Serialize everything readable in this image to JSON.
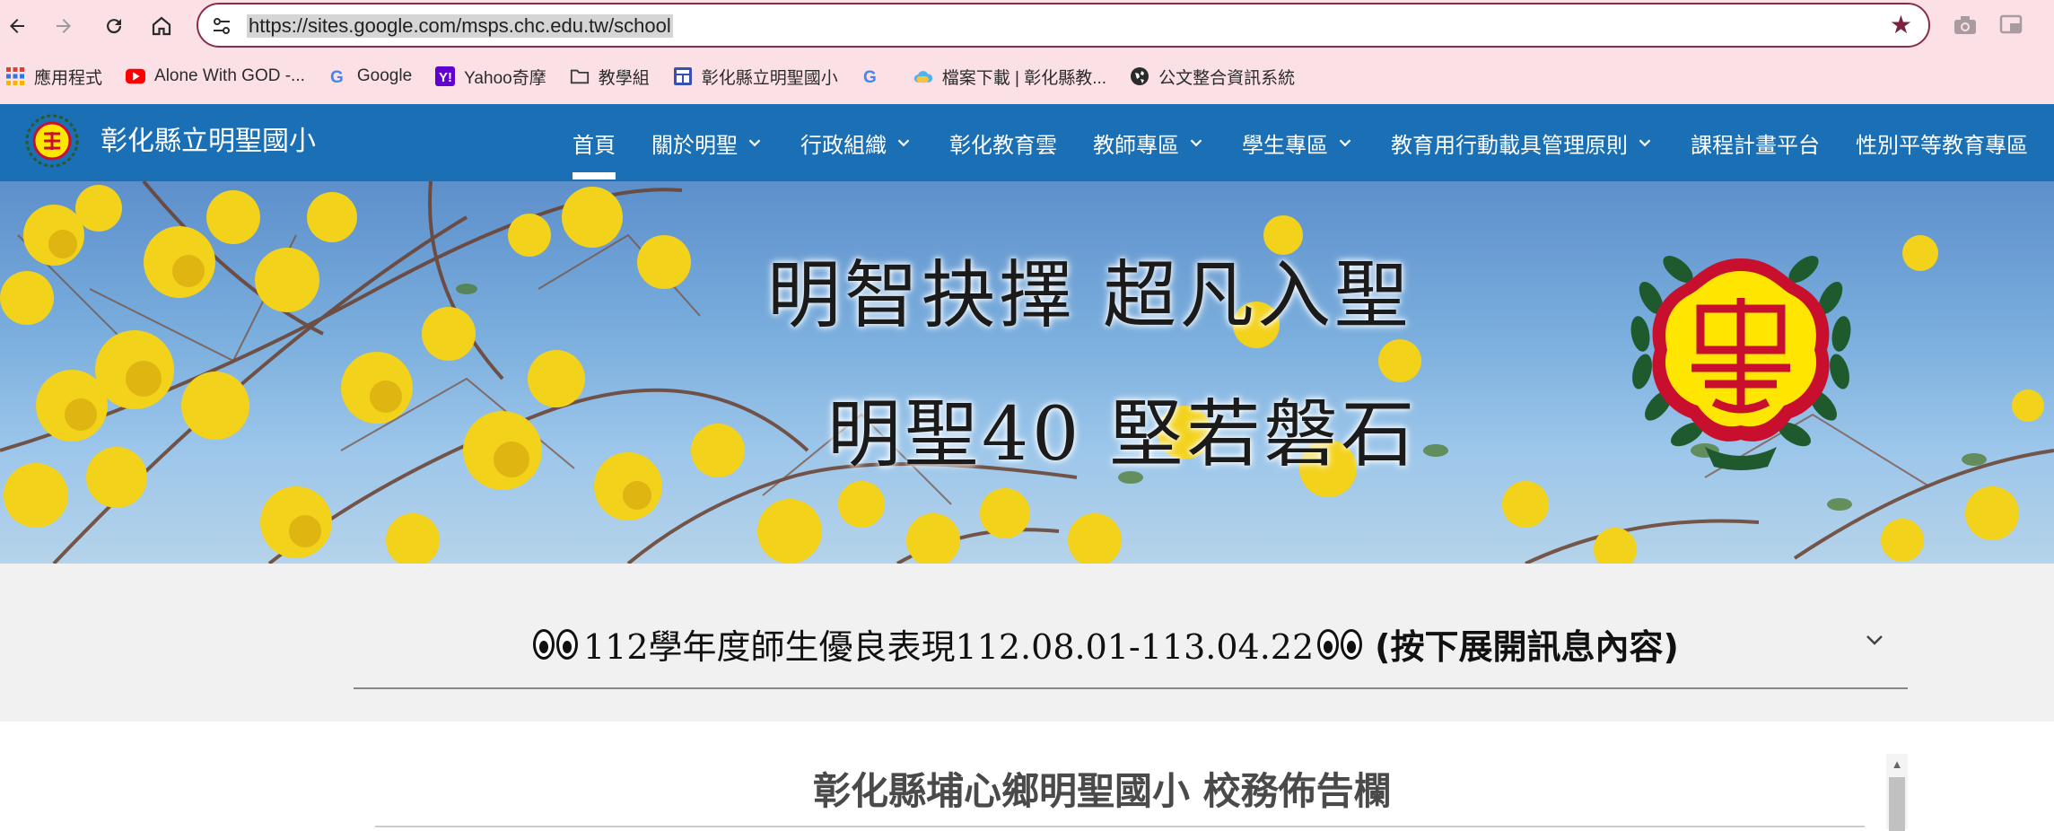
{
  "browser": {
    "url": "https://sites.google.com/msps.chc.edu.tw/school",
    "bookmarks": [
      {
        "label": "應用程式",
        "icon": "apps-grid-icon"
      },
      {
        "label": "Alone With GOD -...",
        "icon": "youtube-icon"
      },
      {
        "label": "Google",
        "icon": "google-icon"
      },
      {
        "label": "Yahoo奇摩",
        "icon": "yahoo-icon"
      },
      {
        "label": "教學組",
        "icon": "folder-icon"
      },
      {
        "label": "彰化縣立明聖國小",
        "icon": "sites-icon"
      },
      {
        "label": "",
        "icon": "google-icon"
      },
      {
        "label": "檔案下載 | 彰化縣教...",
        "icon": "cloud-icon"
      },
      {
        "label": "公文整合資訊系統",
        "icon": "globe-icon"
      }
    ]
  },
  "site": {
    "title": "彰化縣立明聖國小",
    "nav": [
      {
        "label": "首頁",
        "dropdown": false,
        "active": true
      },
      {
        "label": "關於明聖",
        "dropdown": true,
        "active": false
      },
      {
        "label": "行政組織",
        "dropdown": true,
        "active": false
      },
      {
        "label": "彰化教育雲",
        "dropdown": false,
        "active": false
      },
      {
        "label": "教師專區",
        "dropdown": true,
        "active": false
      },
      {
        "label": "學生專區",
        "dropdown": true,
        "active": false
      },
      {
        "label": "教育用行動載具管理原則",
        "dropdown": true,
        "active": false
      },
      {
        "label": "課程計畫平台",
        "dropdown": false,
        "active": false
      },
      {
        "label": "性別平等教育專區",
        "dropdown": false,
        "active": false
      }
    ]
  },
  "banner": {
    "line1": "明智抉擇  超凡入聖",
    "line2": "明聖40 堅若磐石"
  },
  "notice": {
    "title": "112學年度師生優良表現112.08.01-113.04.22",
    "hint": "(按下展開訊息內容)"
  },
  "board": {
    "title": "彰化縣埔心鄉明聖國小 校務佈告欄"
  },
  "colors": {
    "chrome_bg": "#fbe0e6",
    "header_blue": "#1a6fb5",
    "omnibox_border": "#8b2d4a",
    "emblem_red": "#c8102e",
    "emblem_yellow": "#ffe600",
    "wreath_green": "#1f5a2e"
  }
}
